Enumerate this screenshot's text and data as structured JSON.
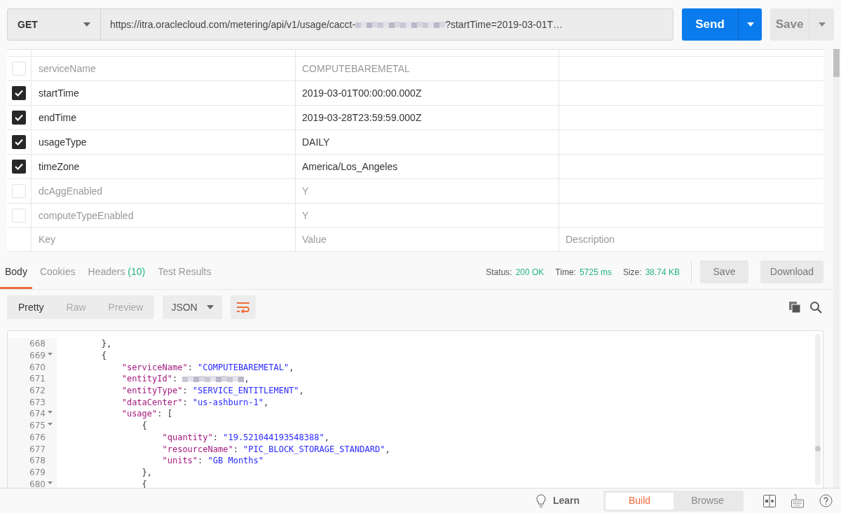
{
  "request": {
    "method": "GET",
    "url_prefix": "https://itra.oraclecloud.com/metering/api/v1/usage/cacct-",
    "url_suffix": "?startTime=2019-03-01T…",
    "send": "Send",
    "save": "Save"
  },
  "params": {
    "rows": [
      {
        "key": "serviceName",
        "value": "COMPUTEBAREMETAL",
        "checked": false
      },
      {
        "key": "startTime",
        "value": "2019-03-01T00:00:00.000Z",
        "checked": true
      },
      {
        "key": "endTime",
        "value": "2019-03-28T23:59:59.000Z",
        "checked": true
      },
      {
        "key": "usageType",
        "value": "DAILY",
        "checked": true
      },
      {
        "key": "timeZone",
        "value": "America/Los_Angeles",
        "checked": true
      },
      {
        "key": "dcAggEnabled",
        "value": "Y",
        "checked": false
      },
      {
        "key": "computeTypeEnabled",
        "value": "Y",
        "checked": false
      }
    ],
    "new_row": {
      "key_placeholder": "Key",
      "value_placeholder": "Value",
      "description_placeholder": "Description"
    }
  },
  "response": {
    "tabs": [
      {
        "label": "Body",
        "selected": true
      },
      {
        "label": "Cookies",
        "selected": false
      },
      {
        "label": "Headers",
        "count": "(10)",
        "selected": false
      },
      {
        "label": "Test Results",
        "selected": false
      }
    ],
    "status": [
      {
        "label": "Status:",
        "value": "200 OK"
      },
      {
        "label": "Time:",
        "value": "5725 ms"
      },
      {
        "label": "Size:",
        "value": "38.74 KB"
      }
    ],
    "buttons": [
      "Save",
      "Download"
    ],
    "views": [
      {
        "label": "Pretty",
        "selected": true
      },
      {
        "label": "Raw",
        "selected": false
      },
      {
        "label": "Preview",
        "selected": false
      }
    ],
    "format": "JSON",
    "lines": [
      {
        "number": "668",
        "fold": false,
        "tokens": [
          {
            "kind": "punct",
            "text": "        },"
          }
        ]
      },
      {
        "number": "669",
        "fold": true,
        "tokens": [
          {
            "kind": "punct",
            "text": "        {"
          }
        ]
      },
      {
        "number": "670",
        "fold": false,
        "tokens": [
          {
            "kind": "key",
            "text": "            \"serviceName\""
          },
          {
            "kind": "punct",
            "text": ": "
          },
          {
            "kind": "string",
            "text": "\"COMPUTEBAREMETAL\""
          },
          {
            "kind": "punct",
            "text": ","
          }
        ]
      },
      {
        "number": "671",
        "fold": false,
        "tokens": [
          {
            "kind": "key",
            "text": "            \"entityId\""
          },
          {
            "kind": "punct",
            "text": ": "
          },
          {
            "kind": "redacted"
          },
          {
            "kind": "punct",
            "text": ","
          }
        ]
      },
      {
        "number": "672",
        "fold": false,
        "tokens": [
          {
            "kind": "key",
            "text": "            \"entityType\""
          },
          {
            "kind": "punct",
            "text": ": "
          },
          {
            "kind": "string",
            "text": "\"SERVICE_ENTITLEMENT\""
          },
          {
            "kind": "punct",
            "text": ","
          }
        ]
      },
      {
        "number": "673",
        "fold": false,
        "tokens": [
          {
            "kind": "key",
            "text": "            \"dataCenter\""
          },
          {
            "kind": "punct",
            "text": ": "
          },
          {
            "kind": "string",
            "text": "\"us-ashburn-1\""
          },
          {
            "kind": "punct",
            "text": ","
          }
        ]
      },
      {
        "number": "674",
        "fold": true,
        "tokens": [
          {
            "kind": "key",
            "text": "            \"usage\""
          },
          {
            "kind": "punct",
            "text": ": ["
          }
        ]
      },
      {
        "number": "675",
        "fold": true,
        "tokens": [
          {
            "kind": "punct",
            "text": "                {"
          }
        ]
      },
      {
        "number": "676",
        "fold": false,
        "tokens": [
          {
            "kind": "key",
            "text": "                    \"quantity\""
          },
          {
            "kind": "punct",
            "text": ": "
          },
          {
            "kind": "string",
            "text": "\"19.521044193548388\""
          },
          {
            "kind": "punct",
            "text": ","
          }
        ]
      },
      {
        "number": "677",
        "fold": false,
        "tokens": [
          {
            "kind": "key",
            "text": "                    \"resourceName\""
          },
          {
            "kind": "punct",
            "text": ": "
          },
          {
            "kind": "string",
            "text": "\"PIC_BLOCK_STORAGE_STANDARD\""
          },
          {
            "kind": "punct",
            "text": ","
          }
        ]
      },
      {
        "number": "678",
        "fold": false,
        "tokens": [
          {
            "kind": "key",
            "text": "                    \"units\""
          },
          {
            "kind": "punct",
            "text": ": "
          },
          {
            "kind": "string",
            "text": "\"GB Months\""
          }
        ]
      },
      {
        "number": "679",
        "fold": false,
        "tokens": [
          {
            "kind": "punct",
            "text": "                },"
          }
        ]
      },
      {
        "number": "680",
        "fold": true,
        "tokens": [
          {
            "kind": "punct",
            "text": "                {"
          }
        ]
      }
    ]
  },
  "footer": {
    "learn": "Learn",
    "modes": [
      {
        "label": "Build",
        "selected": true
      },
      {
        "label": "Browse",
        "selected": false
      }
    ]
  }
}
